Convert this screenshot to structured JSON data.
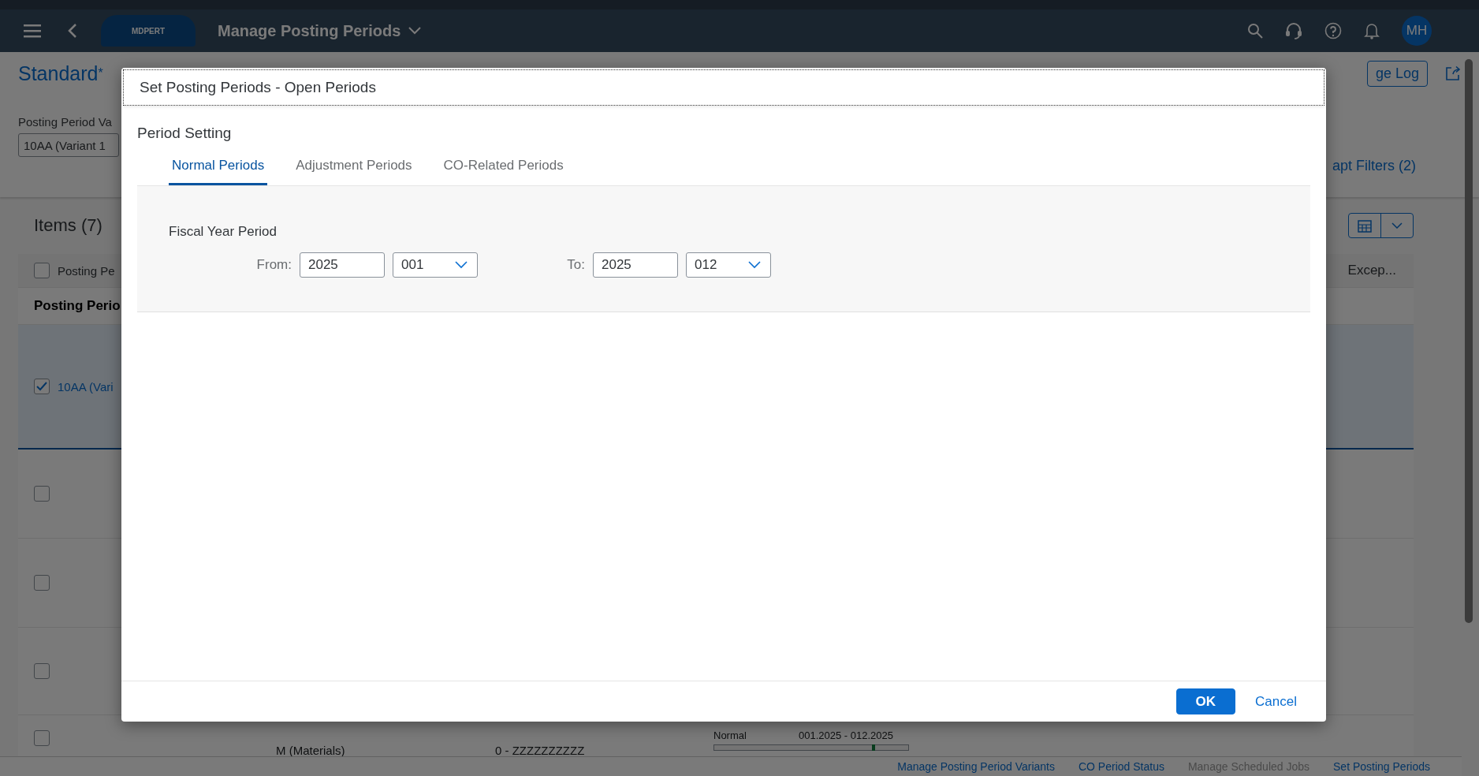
{
  "shell": {
    "title": "Manage Posting Periods",
    "logo": "MDPERT",
    "avatar": "MH"
  },
  "page": {
    "variant": "Standard",
    "variant_modified_mark": "*",
    "filter_label": "Posting Period Va",
    "filter_value": "10AA (Variant 1",
    "change_log_button": "ge Log",
    "adapt_filters": "apt Filters (2)"
  },
  "table": {
    "title": "Items (7)",
    "select_all_checked": false,
    "columns": [
      "Posting Pe",
      "Excep..."
    ],
    "group_header": "Posting Perio",
    "rows": [
      {
        "selected": true,
        "link": "10AA (Vari"
      },
      {
        "selected": false
      },
      {
        "selected": false
      },
      {
        "selected": false
      },
      {
        "selected": false,
        "cells": [
          "M (Materials)",
          "0 - ZZZZZZZZZZ"
        ],
        "period_type": "Normal",
        "period_range": "001.2025 - 012.2025"
      }
    ]
  },
  "footer_links": [
    {
      "label": "Manage Posting Period Variants",
      "disabled": false
    },
    {
      "label": "CO Period Status",
      "disabled": false
    },
    {
      "label": "Manage Scheduled Jobs",
      "disabled": true
    },
    {
      "label": "Set Posting Periods",
      "disabled": false
    }
  ],
  "dialog": {
    "title": "Set Posting Periods - Open Periods",
    "section_title": "Period Setting",
    "tabs": [
      {
        "label": "Normal Periods",
        "selected": true
      },
      {
        "label": "Adjustment Periods",
        "selected": false
      },
      {
        "label": "CO-Related Periods",
        "selected": false
      }
    ],
    "group_label": "Fiscal Year Period",
    "from": {
      "label": "From:",
      "year": "2025",
      "period": "001"
    },
    "to": {
      "label": "To:",
      "year": "2025",
      "period": "012"
    },
    "buttons": [
      {
        "label": "OK",
        "kind": "emphasized"
      },
      {
        "label": "Cancel",
        "kind": "transparent"
      }
    ]
  }
}
